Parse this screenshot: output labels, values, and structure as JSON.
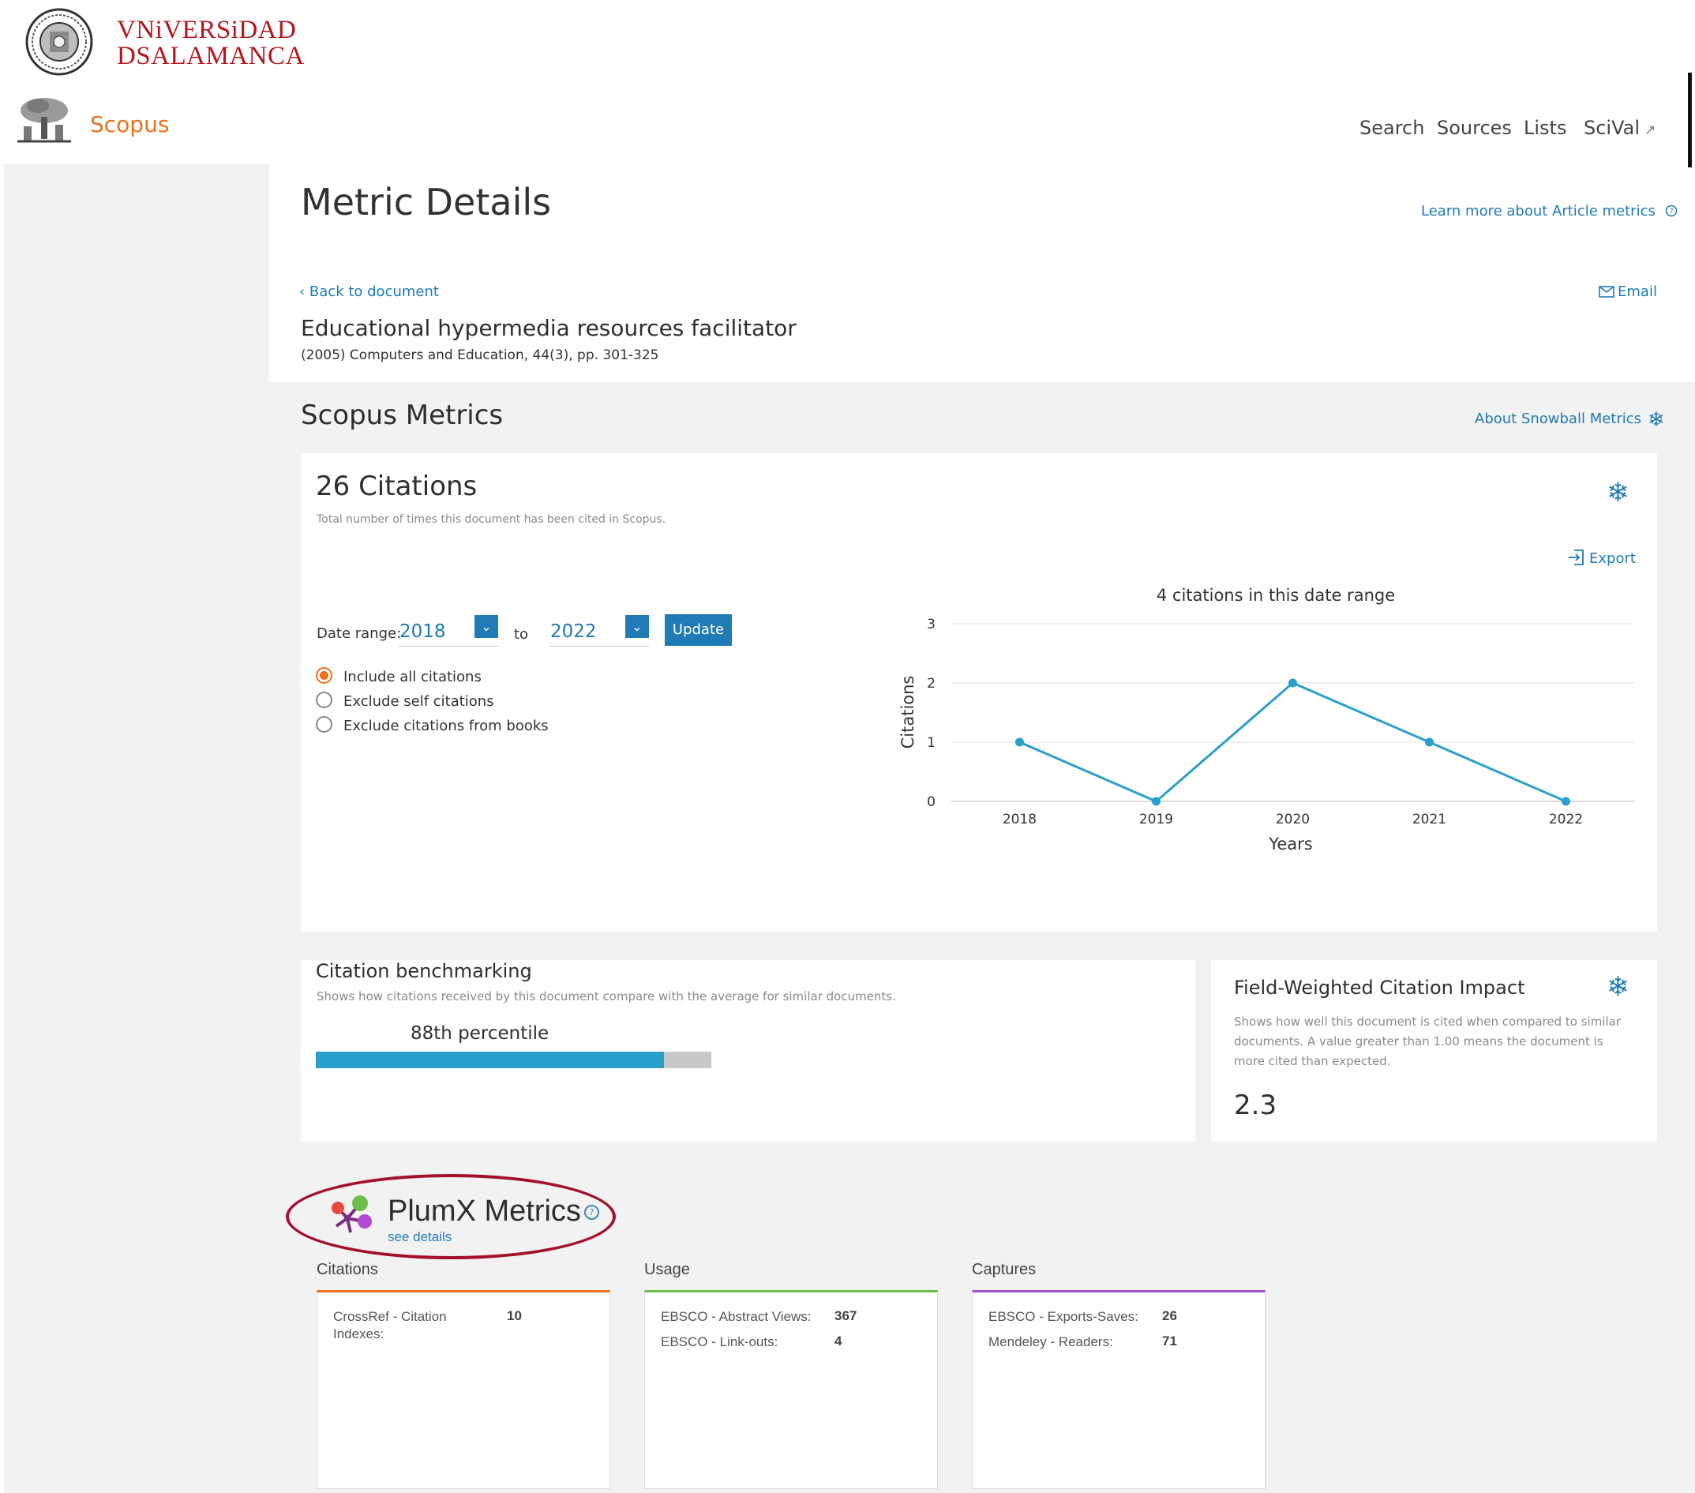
{
  "brand": {
    "university_line1": "VNiVERSiDAD",
    "university_line2": "DSALAMANCA",
    "product": "Scopus",
    "colors": {
      "university_red": "#b4161c",
      "scopus_orange": "#e9711c",
      "link_blue": "#1f7ab6"
    }
  },
  "nav": {
    "search": "Search",
    "sources": "Sources",
    "lists": "Lists",
    "scival": "SciVal",
    "scival_icon": "external-link-icon"
  },
  "page": {
    "title": "Metric Details",
    "learn_more": "Learn more about Article metrics",
    "back_link": "Back to document",
    "email": "Email"
  },
  "document": {
    "title": "Educational hypermedia resources facilitator",
    "meta": "(2005) Computers and Education, 44(3), pp. 301-325"
  },
  "scopus_metrics": {
    "title": "Scopus Metrics",
    "about_link": "About Snowball Metrics",
    "citations": {
      "count_label": "26 Citations",
      "description": "Total number of times this document has been cited in Scopus.",
      "export": "Export",
      "date_range_label": "Date range:",
      "from_year": "2018",
      "to_label": "to",
      "to_year": "2022",
      "update_button": "Update",
      "options": [
        {
          "label": "Include all citations",
          "selected": true
        },
        {
          "label": "Exclude self citations",
          "selected": false
        },
        {
          "label": "Exclude citations from books",
          "selected": false
        }
      ]
    },
    "benchmarking": {
      "title": "Citation benchmarking",
      "description": "Shows how citations received by this document compare with the average for similar documents.",
      "percentile_label": "88th percentile",
      "percentile_value": 88
    },
    "fwci": {
      "title": "Field-Weighted Citation Impact",
      "description": "Shows how well this document is cited when compared to similar documents. A value greater than 1.00 means the document is more cited than expected.",
      "value": "2.3"
    }
  },
  "chart_data": {
    "type": "line",
    "title": "4 citations in this date range",
    "xlabel": "Years",
    "ylabel": "Citations",
    "categories": [
      "2018",
      "2019",
      "2020",
      "2021",
      "2022"
    ],
    "values": [
      1,
      0,
      2,
      1,
      0
    ],
    "ylim": [
      0,
      3
    ],
    "yticks": [
      0,
      1,
      2,
      3
    ],
    "grid": true,
    "color": "#2a9fcc"
  },
  "plumx": {
    "title": "PlumX Metrics",
    "see_details": "see details",
    "ellipse_color": "#a3102a",
    "categories": [
      {
        "name": "Citations",
        "color": "#e9711c",
        "rows": [
          {
            "label_line1": "CrossRef - Citation",
            "label_line2": "Indexes:",
            "value": "10"
          }
        ]
      },
      {
        "name": "Usage",
        "color": "#6cc04a",
        "rows": [
          {
            "label": "EBSCO - Abstract Views:",
            "value": "367"
          },
          {
            "label": "EBSCO - Link-outs:",
            "value": "4"
          }
        ]
      },
      {
        "name": "Captures",
        "color": "#a352cc",
        "rows": [
          {
            "label": "EBSCO - Exports-Saves:",
            "value": "26"
          },
          {
            "label": "Mendeley - Readers:",
            "value": "71"
          }
        ]
      }
    ]
  }
}
